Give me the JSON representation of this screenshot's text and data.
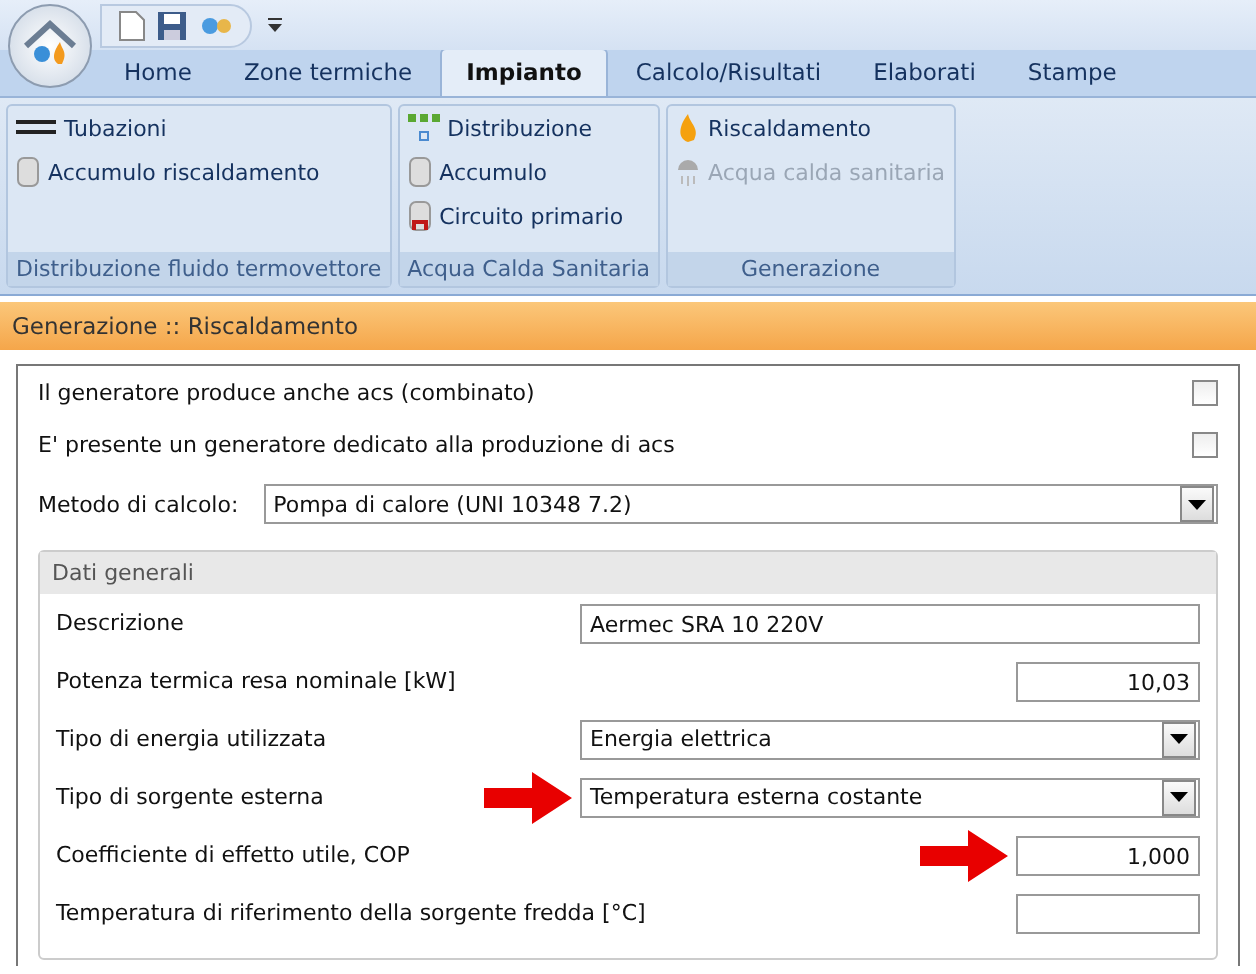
{
  "tabs": [
    {
      "label": "Home",
      "selected": false
    },
    {
      "label": "Zone termiche",
      "selected": false
    },
    {
      "label": "Impianto",
      "selected": true
    },
    {
      "label": "Calcolo/Risultati",
      "selected": false
    },
    {
      "label": "Elaborati",
      "selected": false
    },
    {
      "label": "Stampe",
      "selected": false
    }
  ],
  "ribbon_groups": [
    {
      "title": "Distribuzione fluido termovettore",
      "items": [
        {
          "label": "Tubazioni",
          "kind": "pipe",
          "disabled": false
        },
        {
          "label": "Accumulo riscaldamento",
          "kind": "tank",
          "disabled": false
        }
      ]
    },
    {
      "title": "Acqua Calda Sanitaria",
      "items": [
        {
          "label": "Distribuzione",
          "kind": "network",
          "disabled": false
        },
        {
          "label": "Accumulo",
          "kind": "tank",
          "disabled": false
        },
        {
          "label": "Circuito primario",
          "kind": "circuit",
          "disabled": false
        }
      ]
    },
    {
      "title": "Generazione",
      "items": [
        {
          "label": "Riscaldamento",
          "kind": "flame",
          "disabled": false
        },
        {
          "label": "Acqua calda sanitaria",
          "kind": "shower",
          "disabled": true
        }
      ]
    }
  ],
  "panel_title": "Generazione :: Riscaldamento",
  "checks": [
    {
      "label": "Il generatore produce anche acs (combinato)",
      "checked": false
    },
    {
      "label": "E' presente un generatore dedicato alla produzione di acs",
      "checked": false
    }
  ],
  "method": {
    "label": "Metodo di calcolo:",
    "value": "Pompa di calore (UNI 10348 7.2)"
  },
  "group": {
    "title": "Dati generali",
    "fields": [
      {
        "label": "Descrizione",
        "kind": "text",
        "value": "Aermec SRA 10 220V",
        "arrow": false
      },
      {
        "label": "Potenza termica resa nominale [kW]",
        "kind": "number",
        "value": "10,03",
        "arrow": false
      },
      {
        "label": "Tipo di energia utilizzata",
        "kind": "select",
        "value": "Energia elettrica",
        "arrow": false
      },
      {
        "label": "Tipo di sorgente esterna",
        "kind": "select",
        "value": "Temperatura esterna costante",
        "arrow": true
      },
      {
        "label": "Coefficiente di effetto utile, COP",
        "kind": "number",
        "value": "1,000",
        "arrow": true
      },
      {
        "label": "Temperatura di riferimento della sorgente fredda [°C]",
        "kind": "number",
        "arrow": false
      }
    ]
  }
}
